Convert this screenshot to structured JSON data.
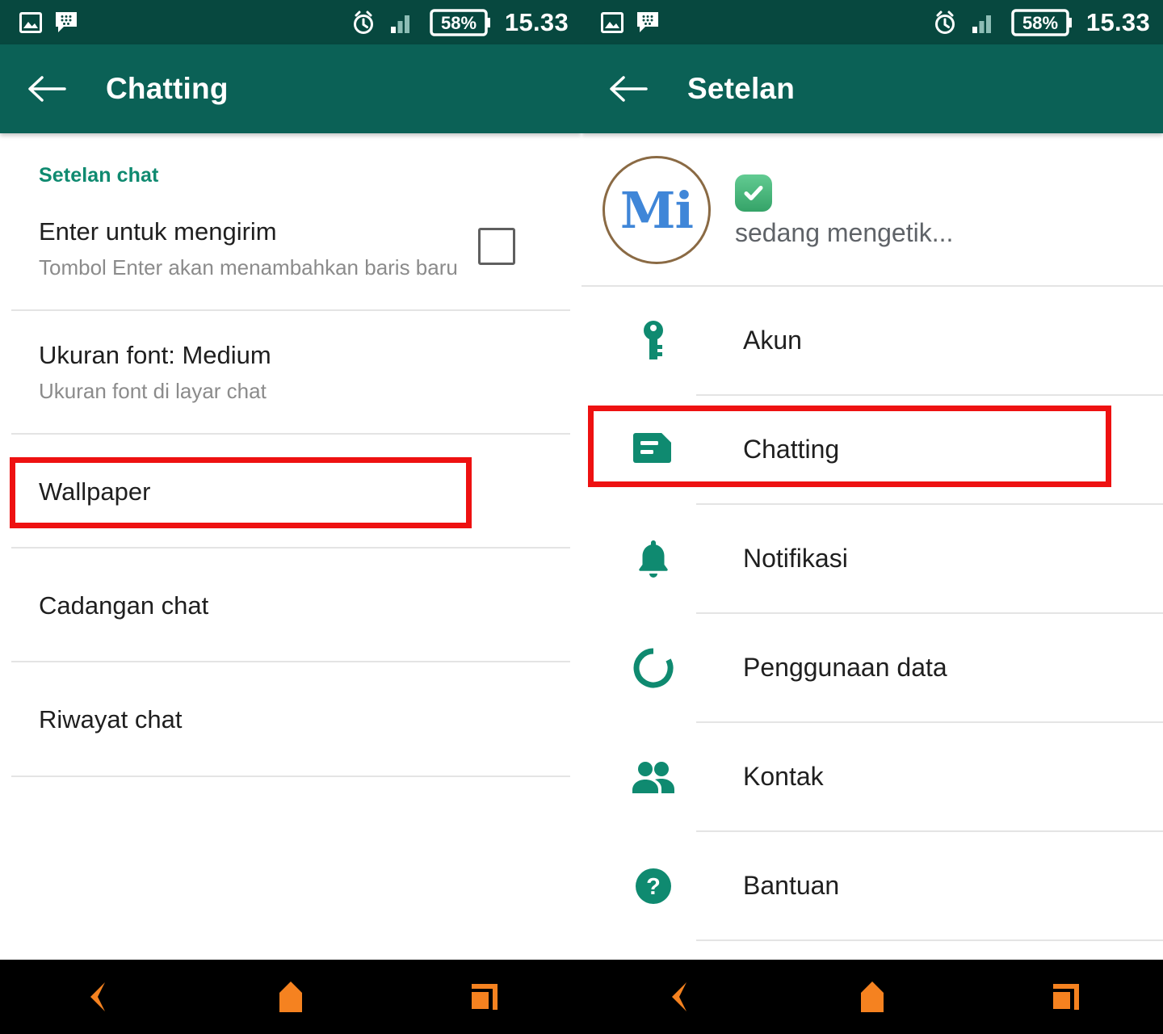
{
  "status_bar": {
    "time": "15.33",
    "battery": "58%",
    "icons": [
      "gallery-icon",
      "bbm-icon",
      "alarm-icon",
      "signal-icon",
      "battery-icon"
    ]
  },
  "left_panel": {
    "appbar": {
      "back": "back-arrow",
      "title": "Chatting"
    },
    "section_title": "Setelan chat",
    "items": [
      {
        "title": "Enter untuk mengirim",
        "subtitle": "Tombol Enter akan menambahkan baris baru",
        "checkbox": true,
        "checked": false
      },
      {
        "title": "Ukuran font: Medium",
        "subtitle": "Ukuran font di layar chat",
        "checkbox": false
      },
      {
        "title": "Wallpaper",
        "subtitle": "",
        "checkbox": false,
        "highlighted": true
      },
      {
        "title": "Cadangan chat",
        "subtitle": "",
        "checkbox": false
      },
      {
        "title": "Riwayat chat",
        "subtitle": "",
        "checkbox": false
      }
    ]
  },
  "right_panel": {
    "appbar": {
      "back": "back-arrow",
      "title": "Setelan"
    },
    "profile": {
      "avatar_text": "Mi",
      "status": "sedang mengetik...",
      "badge": "verified-check-icon"
    },
    "menu": [
      {
        "label": "Akun",
        "icon": "key-icon"
      },
      {
        "label": "Chatting",
        "icon": "chat-bubble-icon",
        "highlighted": true
      },
      {
        "label": "Notifikasi",
        "icon": "bell-icon"
      },
      {
        "label": "Penggunaan data",
        "icon": "data-usage-icon"
      },
      {
        "label": "Kontak",
        "icon": "contacts-icon"
      },
      {
        "label": "Bantuan",
        "icon": "help-circle-icon"
      }
    ]
  },
  "nav_bar": {
    "buttons": [
      "back-nav-icon",
      "home-nav-icon",
      "recents-nav-icon"
    ]
  },
  "colors": {
    "status_bar": "#07483f",
    "app_bar": "#0b6156",
    "accent_teal": "#0f8a70",
    "section_title": "#0f8a70",
    "highlight_red": "#ee1111",
    "nav_orange": "#f58220",
    "avatar_blue": "#3f86d8",
    "avatar_ring": "#8a6a44"
  }
}
